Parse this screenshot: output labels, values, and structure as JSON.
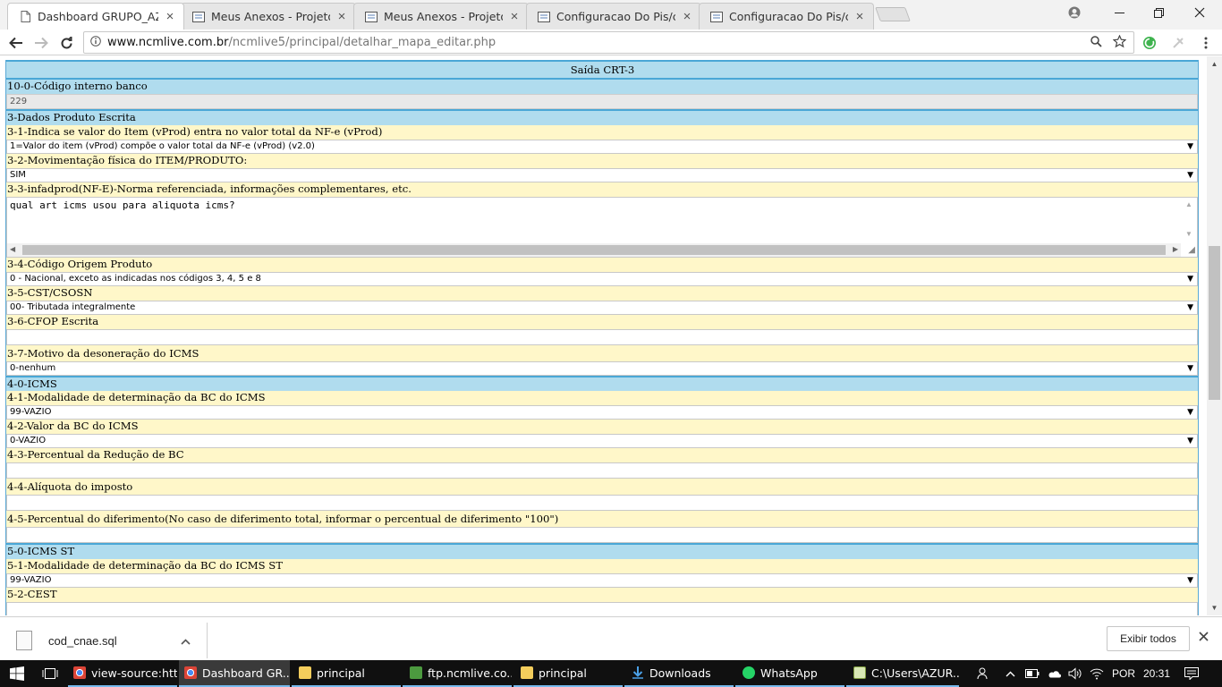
{
  "browser": {
    "tabs": [
      {
        "title": "Dashboard GRUPO_AZUR",
        "favicon": "page-icon",
        "active": true
      },
      {
        "title": "Meus Anexos - Projeto A",
        "favicon": "document-icon",
        "active": false
      },
      {
        "title": "Meus Anexos - Projeto A",
        "favicon": "document-icon",
        "active": false
      },
      {
        "title": "Configuracao Do Pis/cof",
        "favicon": "document-icon",
        "active": false
      },
      {
        "title": "Configuracao Do Pis/cof",
        "favicon": "document-icon",
        "active": false
      }
    ],
    "url_host": "www.ncmlive.com.br",
    "url_path": "/ncmlive5/principal/detalhar_mapa_editar.php"
  },
  "form": {
    "title": "Saída CRT-3",
    "code_label": "10-0-Código interno banco",
    "code_value": "229",
    "sec3": "3-Dados Produto Escrita",
    "f31_label": "3-1-Indica se valor do Item (vProd) entra no valor total da NF-e (vProd)",
    "f31_value": "1=Valor do item (vProd) compõe o valor total da NF-e (vProd) (v2.0)",
    "f32_label": "3-2-Movimentação física do ITEM/PRODUTO:",
    "f32_value": "SIM",
    "f33_label": "3-3-infadprod(NF-E)-Norma referenciada, informações complementares, etc.",
    "f33_value": "qual art icms usou para aliquota icms?",
    "f34_label": "3-4-Código Origem Produto",
    "f34_value": "0 - Nacional, exceto as indicadas nos códigos 3, 4, 5 e 8",
    "f35_label": "3-5-CST/CSOSN",
    "f35_value": "00- Tributada integralmente",
    "f36_label": "3-6-CFOP Escrita",
    "f37_label": "3-7-Motivo da desoneração do ICMS",
    "f37_value": "0-nenhum",
    "sec4": "4-0-ICMS",
    "f41_label": "4-1-Modalidade de determinação da BC do ICMS",
    "f41_value": "99-VAZIO",
    "f42_label": "4-2-Valor da BC do ICMS",
    "f42_value": "0-VAZIO",
    "f43_label": "4-3-Percentual da Redução de BC",
    "f44_label": "4-4-Alíquota do imposto",
    "f45_label": "4-5-Percentual do diferimento(No caso de diferimento total, informar o percentual de diferimento \"100\")",
    "sec5": "5-0-ICMS ST",
    "f51_label": "5-1-Modalidade de determinação da BC do ICMS ST",
    "f51_value": "99-VAZIO",
    "f52_label": "5-2-CEST"
  },
  "downloads": {
    "file": "cod_cnae.sql",
    "show_all": "Exibir todos"
  },
  "taskbar": {
    "items": [
      {
        "label": "view-source:htt...",
        "icon": "chrome-icon"
      },
      {
        "label": "Dashboard GR...",
        "icon": "chrome-icon"
      },
      {
        "label": "principal",
        "icon": "folder-icon"
      },
      {
        "label": "ftp.ncmlive.co...",
        "icon": "ftp-icon"
      },
      {
        "label": "principal",
        "icon": "folder-icon"
      },
      {
        "label": "Downloads",
        "icon": "download-icon"
      },
      {
        "label": "WhatsApp",
        "icon": "whatsapp-icon"
      },
      {
        "label": "C:\\Users\\AZUR...",
        "icon": "notepad-icon"
      }
    ],
    "lang": "POR",
    "time": "20:31"
  },
  "colors": {
    "header_blue": "#b0dcee",
    "label_yellow": "#fff7c9",
    "border_blue": "#4aa7d6"
  }
}
